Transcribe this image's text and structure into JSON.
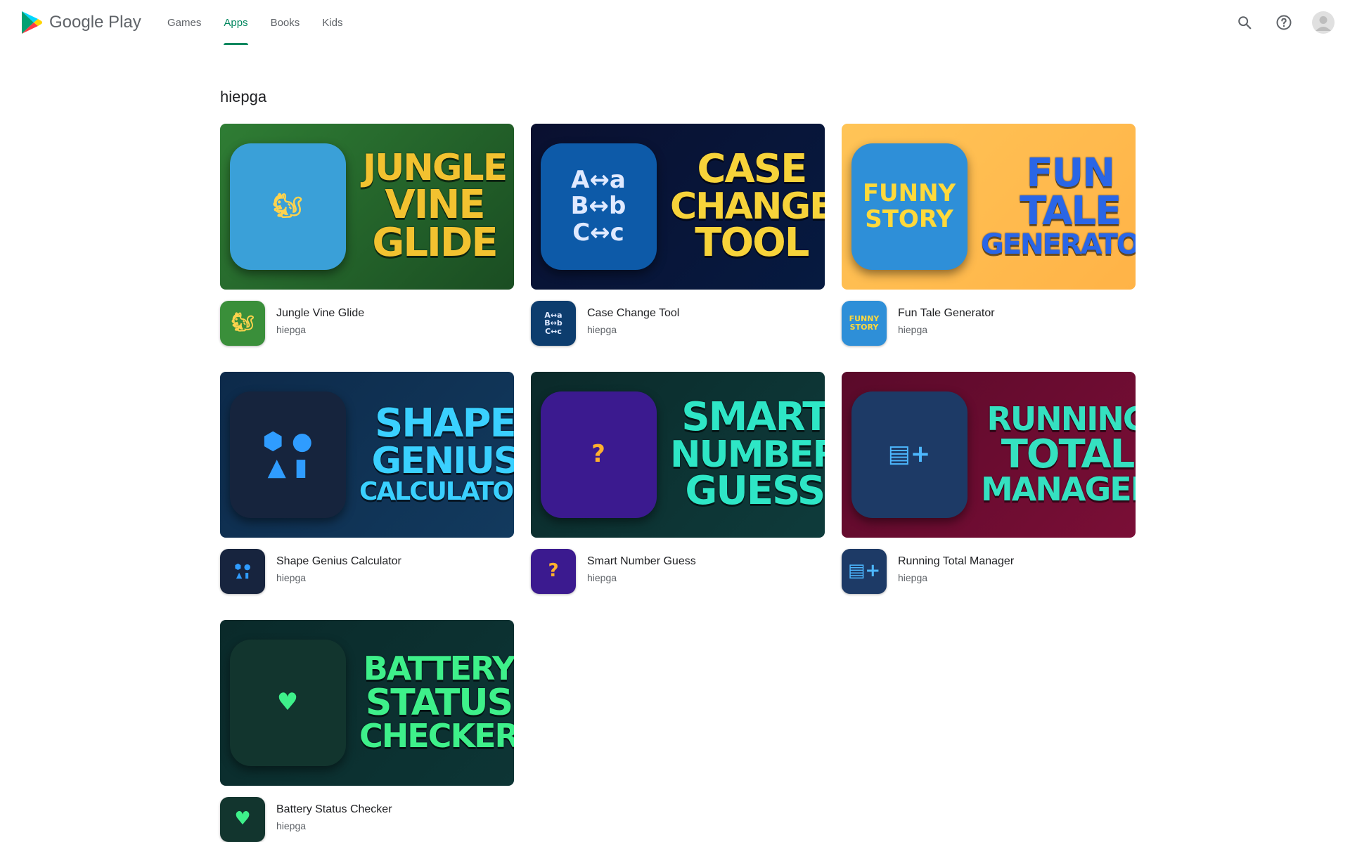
{
  "header": {
    "brand": "Google Play",
    "tabs": [
      {
        "label": "Games",
        "active": false
      },
      {
        "label": "Apps",
        "active": true
      },
      {
        "label": "Books",
        "active": false
      },
      {
        "label": "Kids",
        "active": false
      }
    ],
    "icons": [
      "search-icon",
      "help-icon",
      "account-avatar"
    ]
  },
  "developer": {
    "name": "hiepga"
  },
  "apps": [
    {
      "name": "Jungle Vine Glide",
      "developer": "hiepga",
      "banner_words": [
        "JUNGLE",
        "VINE",
        "GLIDE"
      ],
      "icon_text": "🐿",
      "bg": "#2f7d34",
      "bg2": "#1a4d22",
      "word_color": "#f2c230",
      "art_bg": "#3aa0d8",
      "icon_bg": "#3a8f3a",
      "icon_color": "#ffd34d"
    },
    {
      "name": "Case Change Tool",
      "developer": "hiepga",
      "banner_words": [
        "CASE",
        "CHANGE",
        "TOOL"
      ],
      "icon_text": "A↔a\nB↔b\nC↔c",
      "bg": "#0a1030",
      "bg2": "#061a40",
      "word_color": "#f7d33a",
      "art_bg": "#0d5aa8",
      "icon_bg": "#0d3d6e",
      "icon_color": "#dfe9ff"
    },
    {
      "name": "Fun Tale Generator",
      "developer": "hiepga",
      "banner_words": [
        "FUN",
        "TALE",
        "GENERATOR"
      ],
      "icon_text": "FUNNY\nSTORY",
      "bg": "#ffc457",
      "bg2": "#ffb347",
      "word_color": "#2a66e6",
      "art_bg": "#2e8fd8",
      "icon_bg": "#2e8fd8",
      "icon_color": "#ffd93b"
    },
    {
      "name": "Shape Genius Calculator",
      "developer": "hiepga",
      "banner_words": [
        "SHAPE",
        "GENIUS",
        "CALCULATOR"
      ],
      "icon_text": "⬢ ●\n▲ ▮",
      "bg": "#0d2a4a",
      "bg2": "#123a5e",
      "word_color": "#3ad0ff",
      "art_bg": "#16243d",
      "icon_bg": "#17243e",
      "icon_color": "#2f9cff"
    },
    {
      "name": "Smart Number Guess",
      "developer": "hiepga",
      "banner_words": [
        "SMART",
        "NUMBER",
        "GUESS"
      ],
      "icon_text": "?",
      "bg": "#0b2a2a",
      "bg2": "#0e3b3b",
      "word_color": "#2ee6c6",
      "art_bg": "#3b1a8f",
      "icon_bg": "#3b1a8f",
      "icon_color": "#ffb02e"
    },
    {
      "name": "Running Total Manager",
      "developer": "hiepga",
      "banner_words": [
        "RUNNING",
        "TOTAL",
        "MANAGER"
      ],
      "icon_text": "▤+",
      "bg": "#5a0a2a",
      "bg2": "#7a0e36",
      "word_color": "#35e0c0",
      "art_bg": "#1d3a66",
      "icon_bg": "#1d3a66",
      "icon_color": "#4db8ff"
    },
    {
      "name": "Battery Status Checker",
      "developer": "hiepga",
      "banner_words": [
        "BATTERY",
        "STATUS",
        "CHECKER"
      ],
      "icon_text": "♥",
      "bg": "#0a2a2a",
      "bg2": "#0d3535",
      "word_color": "#3ef08a",
      "art_bg": "#12352e",
      "icon_bg": "#12352e",
      "icon_color": "#3ef08a"
    }
  ]
}
